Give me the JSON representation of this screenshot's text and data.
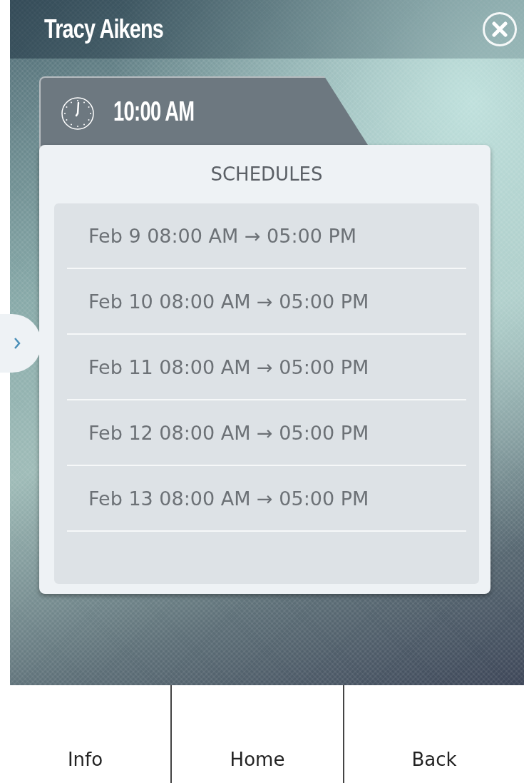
{
  "header": {
    "title": "Tracy Aikens"
  },
  "time_tab": {
    "time": "10:00 AM"
  },
  "schedules": {
    "heading": "SCHEDULES",
    "items": [
      {
        "text": "Feb 9 08:00 AM → 05:00 PM"
      },
      {
        "text": "Feb 10 08:00 AM → 05:00 PM"
      },
      {
        "text": "Feb 11 08:00 AM → 05:00 PM"
      },
      {
        "text": "Feb 12 08:00 AM → 05:00 PM"
      },
      {
        "text": "Feb 13 08:00 AM → 05:00 PM"
      }
    ]
  },
  "bottom_nav": [
    {
      "label": "Info"
    },
    {
      "label": "Home"
    },
    {
      "label": "Back"
    }
  ]
}
